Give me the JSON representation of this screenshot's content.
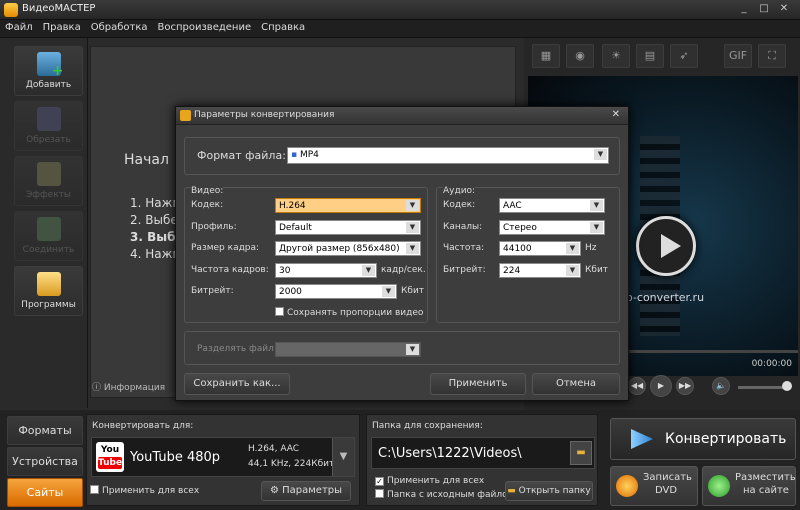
{
  "window": {
    "title": "ВидеоМАСТЕР"
  },
  "menu": [
    "Файл",
    "Правка",
    "Обработка",
    "Воспроизведение",
    "Справка"
  ],
  "sidebar": [
    {
      "label": "Добавить",
      "enabled": true
    },
    {
      "label": "Обрезать",
      "enabled": false
    },
    {
      "label": "Эффекты",
      "enabled": false
    },
    {
      "label": "Соединить",
      "enabled": false
    },
    {
      "label": "Программы",
      "enabled": true
    }
  ],
  "center": {
    "heading": "Начал",
    "steps": [
      "1. Нажм",
      "2. Выбе",
      "3. Выбе",
      "4. Нажм"
    ],
    "info_tab": "Информация"
  },
  "preview": {
    "watermark": "o-converter.ru",
    "time": "00:00:00"
  },
  "dialog": {
    "title": "Параметры конвертирования",
    "format_label": "Формат файла:",
    "format_value": "MP4",
    "video": {
      "section": "Видео:",
      "codec_label": "Кодек:",
      "codec_value": "H.264",
      "profile_label": "Профиль:",
      "profile_value": "Default",
      "size_label": "Размер кадра:",
      "size_value": "Другой размер (856x480)",
      "fps_label": "Частота кадров:",
      "fps_value": "30",
      "fps_unit": "кадр/сек.",
      "bitrate_label": "Битрейт:",
      "bitrate_value": "2000",
      "bitrate_unit": "Кбит",
      "keep_ratio": "Сохранять пропорции видео"
    },
    "audio": {
      "section": "Аудио:",
      "codec_label": "Кодек:",
      "codec_value": "AAC",
      "channels_label": "Каналы:",
      "channels_value": "Стерео",
      "freq_label": "Частота:",
      "freq_value": "44100",
      "freq_unit": "Hz",
      "bitrate_label": "Битрейт:",
      "bitrate_value": "224",
      "bitrate_unit": "Кбит"
    },
    "split_label": "Разделять файл:",
    "save_as": "Сохранить как...",
    "apply": "Применить",
    "cancel": "Отмена"
  },
  "bottom": {
    "tabs": [
      "Форматы",
      "Устройства",
      "Сайты"
    ],
    "convert_for_label": "Конвертировать для:",
    "device_name": "YouTube 480p",
    "device_spec1": "H.264, AAC",
    "device_spec2": "44,1 KHz, 224Кбит",
    "apply_all": "Применить для всех",
    "params": "Параметры",
    "folder_label": "Папка для сохранения:",
    "folder_path": "C:\\Users\\1222\\Videos\\",
    "folder_apply_all": "Применить для всех",
    "folder_source": "Папка с исходным файлом",
    "open_folder": "Открыть папку",
    "convert": "Конвертировать",
    "burn_dvd_1": "Записать",
    "burn_dvd_2": "DVD",
    "publish_1": "Разместить",
    "publish_2": "на сайте"
  },
  "colors": {
    "accent": "#f08a1e",
    "dialog_bg": "#3d3d3d",
    "highlight_field": "#ffcf86"
  }
}
